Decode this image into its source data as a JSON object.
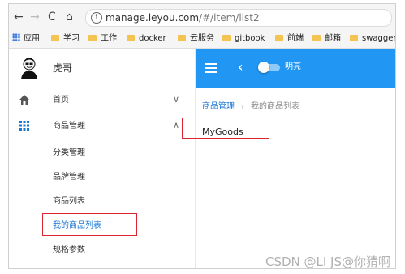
{
  "browser": {
    "url_host": "manage.leyou.com",
    "url_path": "/#/item/list2",
    "nav": {
      "back": "←",
      "forward": "→",
      "reload": "C",
      "home": "⌂"
    }
  },
  "bookmarks": {
    "apps": "应用",
    "items": [
      "学习",
      "工作",
      "docker",
      "云服务",
      "gitbook",
      "前端",
      "邮箱",
      "swagger"
    ]
  },
  "sidebar": {
    "username": "虎哥",
    "menu": [
      {
        "label": "首页",
        "icon": "home-icon",
        "chevron": "∨"
      },
      {
        "label": "商品管理",
        "icon": "grid-icon",
        "chevron": "∧"
      }
    ],
    "submenu": [
      "分类管理",
      "品牌管理",
      "商品列表",
      "我的商品列表",
      "规格参数"
    ]
  },
  "toolbar": {
    "back": "‹",
    "switch_label": "明亮"
  },
  "breadcrumb": {
    "parent": "商品管理",
    "separator": "›",
    "current": "我的商品列表"
  },
  "content": {
    "text": "MyGoods"
  },
  "watermark": "CSDN @LI JS@你猜啊",
  "colors": {
    "primary": "#2196f3",
    "highlight": "#d9262f",
    "link": "#1976d2"
  }
}
